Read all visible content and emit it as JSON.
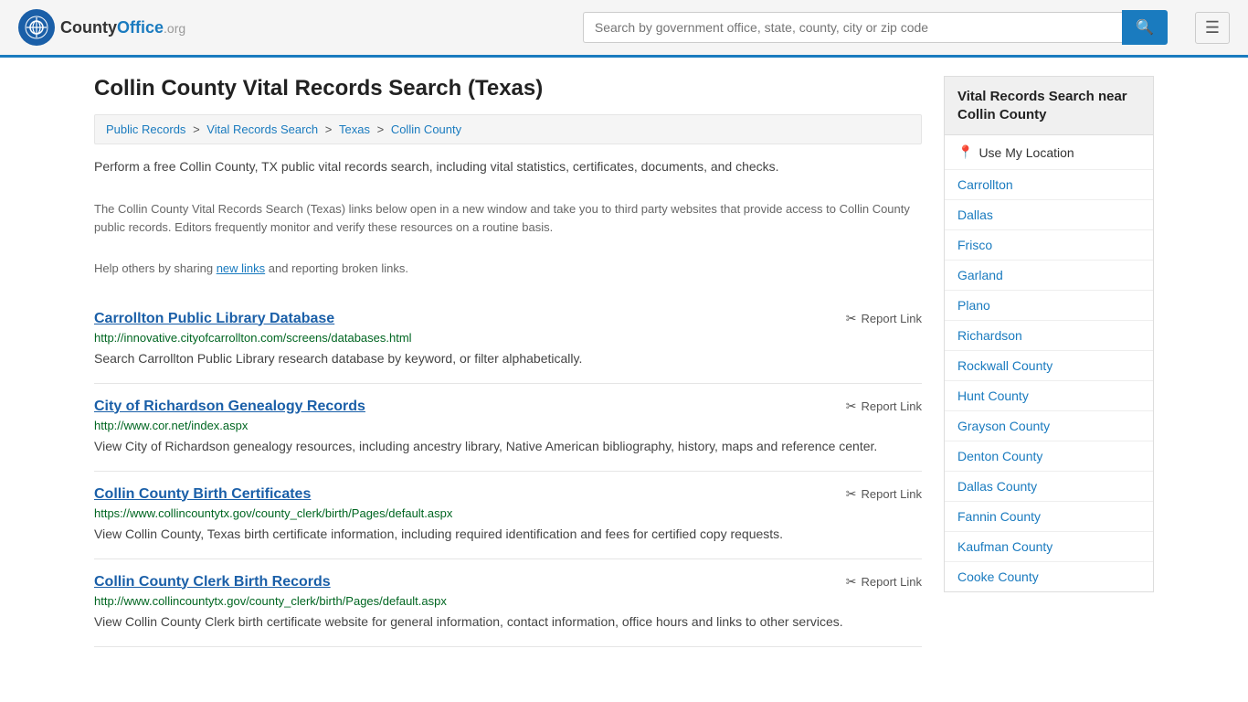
{
  "header": {
    "logo_symbol": "✦",
    "logo_name": "CountyOffice",
    "logo_suffix": ".org",
    "search_placeholder": "Search by government office, state, county, city or zip code",
    "search_value": ""
  },
  "page": {
    "title": "Collin County Vital Records Search (Texas)"
  },
  "breadcrumb": {
    "items": [
      {
        "label": "Public Records",
        "href": "#"
      },
      {
        "label": "Vital Records Search",
        "href": "#"
      },
      {
        "label": "Texas",
        "href": "#"
      },
      {
        "label": "Collin County",
        "href": "#"
      }
    ]
  },
  "description": {
    "text1": "Perform a free Collin County, TX public vital records search, including vital statistics, certificates, documents, and checks.",
    "text2": "The Collin County Vital Records Search (Texas) links below open in a new window and take you to third party websites that provide access to Collin County public records. Editors frequently monitor and verify these resources on a routine basis.",
    "text3_pre": "Help others by sharing ",
    "text3_link": "new links",
    "text3_post": " and reporting broken links."
  },
  "results": [
    {
      "title": "Carrollton Public Library Database",
      "url": "http://innovative.cityofcarrollton.com/screens/databases.html",
      "description": "Search Carrollton Public Library research database by keyword, or filter alphabetically.",
      "report_label": "Report Link"
    },
    {
      "title": "City of Richardson Genealogy Records",
      "url": "http://www.cor.net/index.aspx",
      "description": "View City of Richardson genealogy resources, including ancestry library, Native American bibliography, history, maps and reference center.",
      "report_label": "Report Link"
    },
    {
      "title": "Collin County Birth Certificates",
      "url": "https://www.collincountytx.gov/county_clerk/birth/Pages/default.aspx",
      "description": "View Collin County, Texas birth certificate information, including required identification and fees for certified copy requests.",
      "report_label": "Report Link"
    },
    {
      "title": "Collin County Clerk Birth Records",
      "url": "http://www.collincountytx.gov/county_clerk/birth/Pages/default.aspx",
      "description": "View Collin County Clerk birth certificate website for general information, contact information, office hours and links to other services.",
      "report_label": "Report Link"
    }
  ],
  "sidebar": {
    "header": "Vital Records Search near Collin County",
    "use_location_label": "Use My Location",
    "items": [
      {
        "label": "Carrollton",
        "href": "#"
      },
      {
        "label": "Dallas",
        "href": "#"
      },
      {
        "label": "Frisco",
        "href": "#"
      },
      {
        "label": "Garland",
        "href": "#"
      },
      {
        "label": "Plano",
        "href": "#"
      },
      {
        "label": "Richardson",
        "href": "#"
      },
      {
        "label": "Rockwall County",
        "href": "#"
      },
      {
        "label": "Hunt County",
        "href": "#"
      },
      {
        "label": "Grayson County",
        "href": "#"
      },
      {
        "label": "Denton County",
        "href": "#"
      },
      {
        "label": "Dallas County",
        "href": "#"
      },
      {
        "label": "Fannin County",
        "href": "#"
      },
      {
        "label": "Kaufman County",
        "href": "#"
      },
      {
        "label": "Cooke County",
        "href": "#"
      }
    ]
  }
}
